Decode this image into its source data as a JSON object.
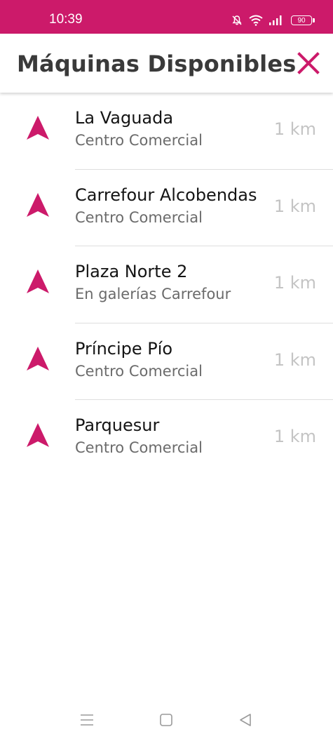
{
  "status_bar": {
    "time": "10:39",
    "battery": "90",
    "icons": [
      "bell-off-icon",
      "wifi-icon",
      "signal-icon",
      "battery-icon"
    ]
  },
  "header": {
    "title": "Máquinas Disponibles",
    "close_icon": "close-icon"
  },
  "colors": {
    "accent": "#cc1a6a",
    "title_text": "#3a3a3a",
    "item_text": "#141414",
    "sub_text": "#6b6b6b",
    "distance_text": "#c4c4c4"
  },
  "machines": [
    {
      "name": "La Vaguada",
      "subtitle": "Centro Comercial",
      "distance": "1 km",
      "icon": "navigation-arrow-icon"
    },
    {
      "name": "Carrefour Alcobendas",
      "subtitle": "Centro Comercial",
      "distance": "1 km",
      "icon": "navigation-arrow-icon"
    },
    {
      "name": "Plaza Norte 2",
      "subtitle": "En galerías Carrefour",
      "distance": "1 km",
      "icon": "navigation-arrow-icon"
    },
    {
      "name": "Príncipe Pío",
      "subtitle": "Centro Comercial",
      "distance": "1 km",
      "icon": "navigation-arrow-icon"
    },
    {
      "name": "Parquesur",
      "subtitle": "Centro Comercial",
      "distance": "1 km",
      "icon": "navigation-arrow-icon"
    }
  ],
  "system_nav": {
    "buttons": [
      "menu-icon",
      "home-icon",
      "back-icon"
    ]
  }
}
